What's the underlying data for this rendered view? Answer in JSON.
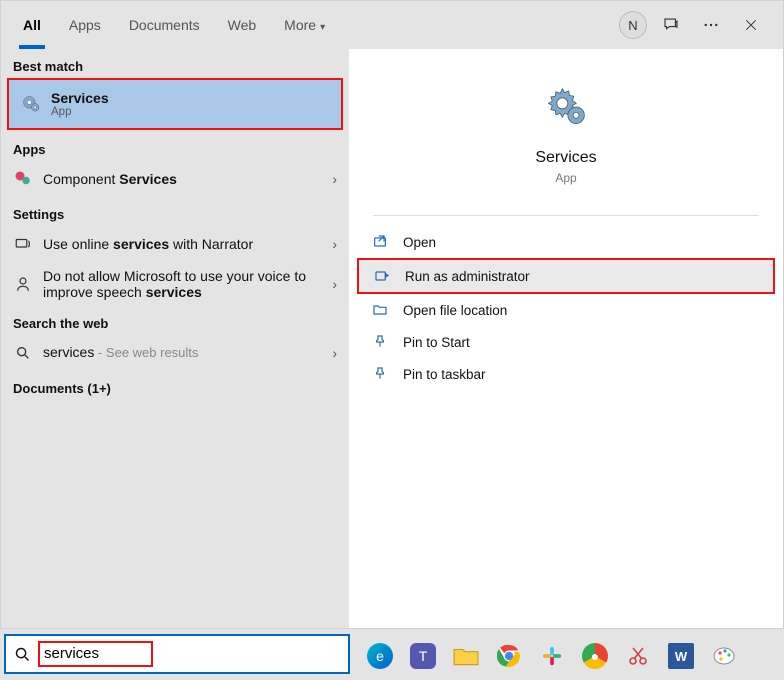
{
  "tabs": {
    "all": "All",
    "apps": "Apps",
    "documents": "Documents",
    "web": "Web",
    "more": "More"
  },
  "avatar_letter": "N",
  "left": {
    "best_header": "Best match",
    "best": {
      "title": "Services",
      "sub": "App"
    },
    "apps_header": "Apps",
    "component": {
      "prefix": "Component ",
      "bold": "Services"
    },
    "settings_header": "Settings",
    "narrator": {
      "p1": "Use online ",
      "b1": "services",
      "p2": " with Narrator"
    },
    "speech": {
      "p1": "Do not allow Microsoft to use your voice to improve speech ",
      "b1": "services"
    },
    "web_header": "Search the web",
    "web": {
      "term": "services",
      "suffix": " - See web results"
    },
    "docs_header": "Documents (1+)"
  },
  "preview": {
    "title": "Services",
    "sub": "App"
  },
  "actions": {
    "open": "Open",
    "runadmin": "Run as administrator",
    "openloc": "Open file location",
    "pinstart": "Pin to Start",
    "pintask": "Pin to taskbar"
  },
  "search_value": "services"
}
